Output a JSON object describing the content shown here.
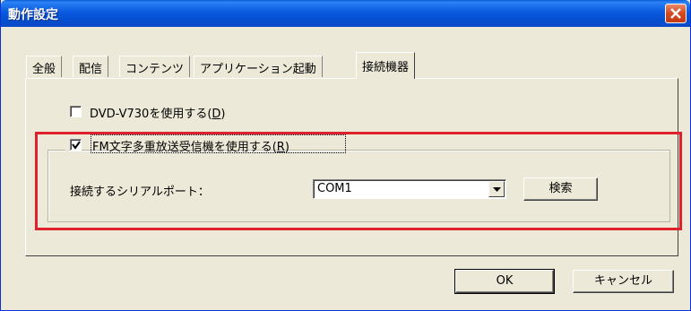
{
  "window": {
    "title": "動作設定"
  },
  "tabs": [
    "全般",
    "配信",
    "コンテンツ",
    "アプリケーション起動",
    "接続機器"
  ],
  "active_tab": "接続機器",
  "options": {
    "dvd_label": "DVD-V730を使用する(",
    "dvd_mnemonic": "D",
    "dvd_suffix": ")",
    "dvd_checked": false,
    "fm_label": "FM文字多重放送受信機を使用する(",
    "fm_mnemonic": "R",
    "fm_suffix": ")",
    "fm_checked": true
  },
  "serial": {
    "label": "接続するシリアルポート：",
    "selected": "COM1",
    "search_label": "検索"
  },
  "footer": {
    "ok_label": "OK",
    "cancel_label": "キャンセル"
  },
  "colors": {
    "titlebar": "#0a59df",
    "highlight": "#e0202a",
    "face": "#ece9d8"
  }
}
